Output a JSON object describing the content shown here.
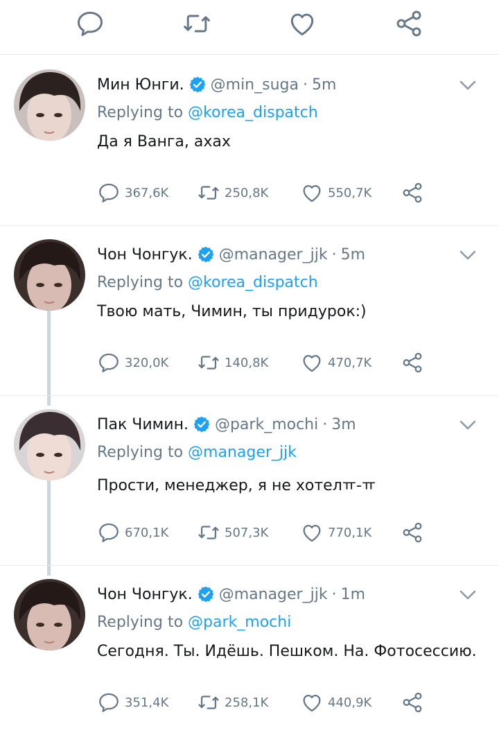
{
  "colors": {
    "accent": "#1da1f2",
    "muted": "#657786",
    "text": "#14171a",
    "divider": "#e6ecf0",
    "thread": "#ccd6dd"
  },
  "top_actions": [
    "reply-icon",
    "retweet-icon",
    "like-icon",
    "share-icon"
  ],
  "replying_prefix": "Replying to",
  "dot": "·",
  "tweets": [
    {
      "name": "Мин Юнги.",
      "handle": "@min_suga",
      "time": "5m",
      "reply_to": "@korea_dispatch",
      "text": "Да я Ванга, ахах",
      "replies": "367,6K",
      "retweets": "250,8K",
      "likes": "550,7K"
    },
    {
      "name": "Чон Чонгук.",
      "handle": "@manager_jjk",
      "time": "5m",
      "reply_to": "@korea_dispatch",
      "text": "Твою мать, Чимин, ты придурок:)",
      "replies": "320,0K",
      "retweets": "140,8K",
      "likes": "470,7K"
    },
    {
      "name": "Пак Чимин.",
      "handle": "@park_mochi",
      "time": "3m",
      "reply_to": "@manager_jjk",
      "text": "Прости, менеджер, я не хотелㅠ-ㅠ",
      "replies": "670,1K",
      "retweets": "507,3K",
      "likes": "770,1K"
    },
    {
      "name": "Чон Чонгук.",
      "handle": "@manager_jjk",
      "time": "1m",
      "reply_to": "@park_mochi",
      "text": "Сегодня. Ты. Идёшь. Пешком. На. Фотосессию.",
      "replies": "351,4K",
      "retweets": "258,1K",
      "likes": "440,9K"
    }
  ]
}
